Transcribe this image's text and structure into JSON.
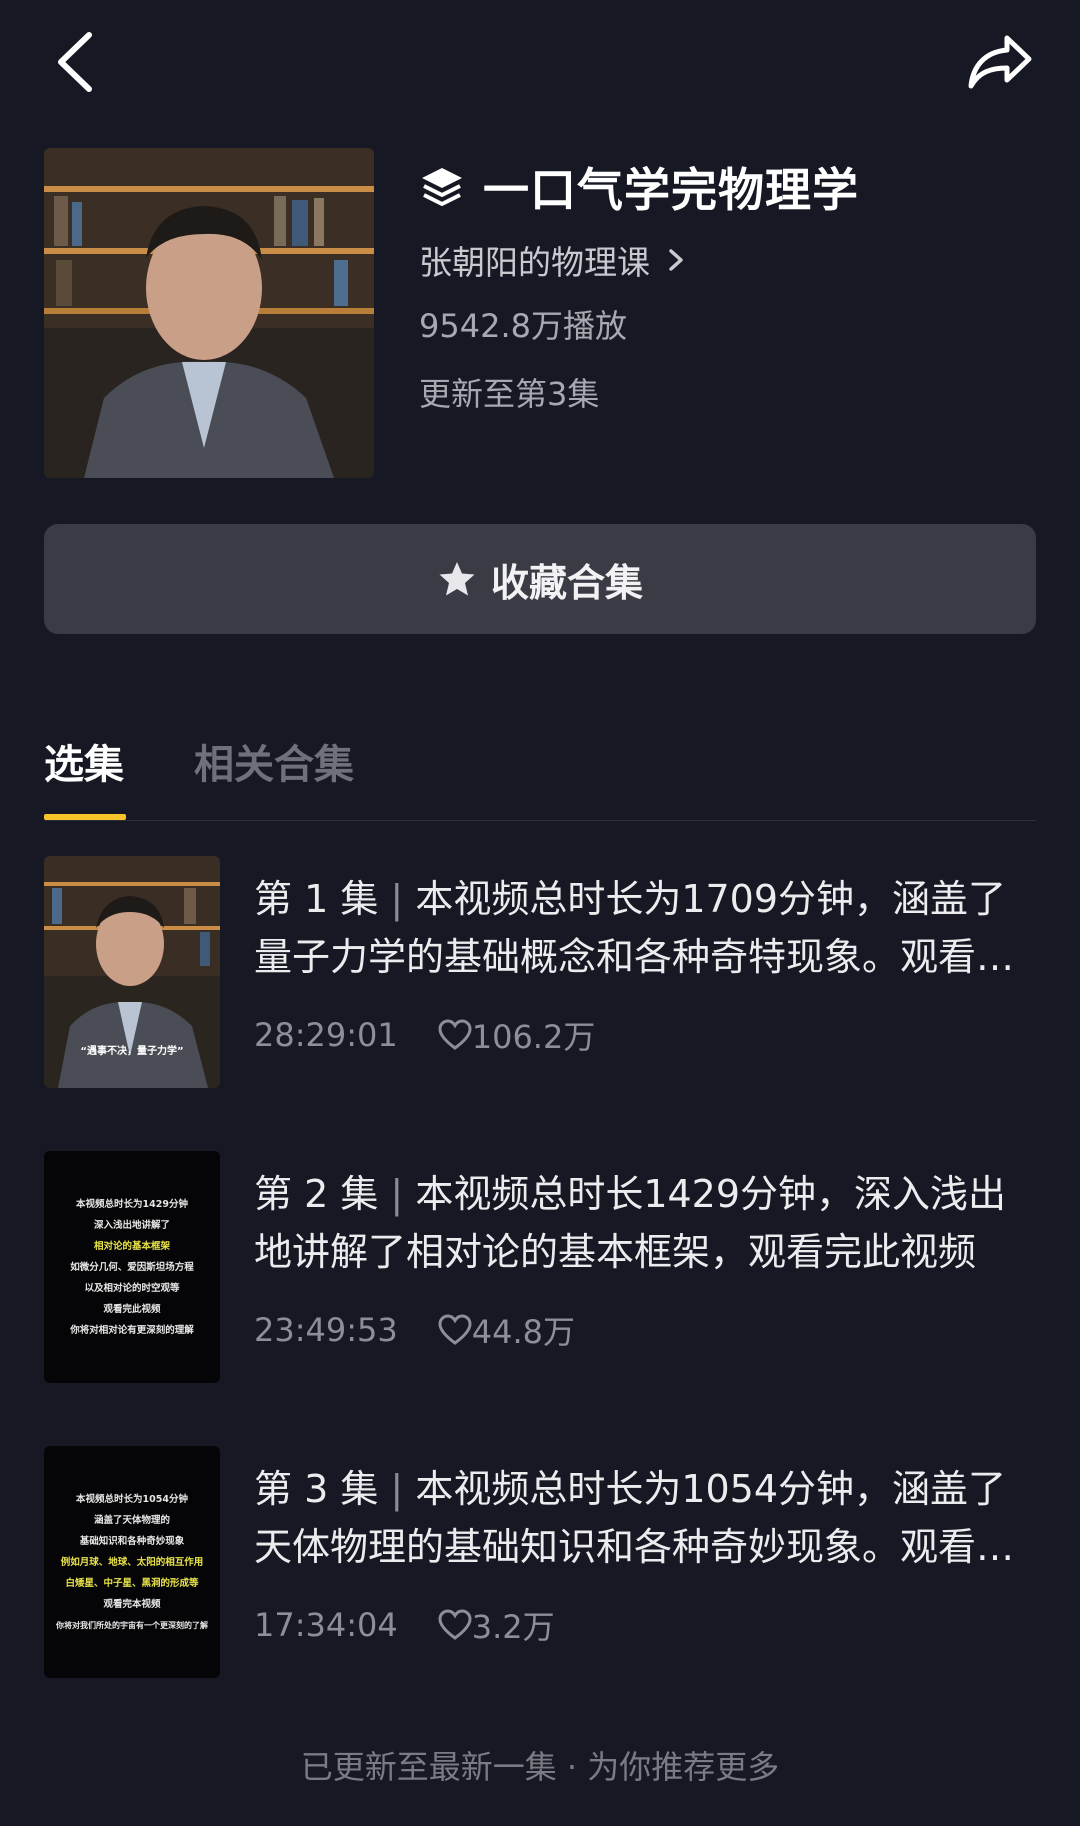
{
  "topbar": {
    "back_icon": "chevron-left-icon",
    "share_icon": "share-arrow-icon"
  },
  "collection": {
    "title": "一口气学完物理学",
    "icon": "layers-icon",
    "author": "张朝阳的物理课",
    "plays": "9542.8万播放",
    "update_status": "更新至第3集"
  },
  "favorite_button": {
    "label": "收藏合集",
    "icon": "star-icon"
  },
  "tabs": [
    {
      "label": "选集",
      "active": true
    },
    {
      "label": "相关合集",
      "active": false
    }
  ],
  "episodes": [
    {
      "number": "第 1 集",
      "description": "本视频总时长为1709分钟，涵盖了量子力学的基础概念和各种奇特现象。观看完此视频",
      "duration": "28:29:01",
      "likes": "106.2万",
      "thumb_caption": "“遇事不决，量子力学”"
    },
    {
      "number": "第 2 集",
      "description": "本视频总时长1429分钟，深入浅出地讲解了相对论的基本框架，观看完此视频",
      "duration": "23:49:53",
      "likes": "44.8万",
      "thumb_lines": [
        "本视频总时长为1429分钟",
        "深入浅出地讲解了",
        "相对论的基本框架",
        "如微分几何、爱因斯坦场方程",
        "以及相对论的时空观等",
        "观看完此视频",
        "你将对相对论有更深刻的理解"
      ]
    },
    {
      "number": "第 3 集",
      "description": "本视频总时长为1054分钟，涵盖了天体物理的基础知识和各种奇妙现象。观看完此视频",
      "duration": "17:34:04",
      "likes": "3.2万",
      "thumb_lines": [
        "本视频总时长为1054分钟",
        "涵盖了天体物理的",
        "基础知识和各种奇妙现象",
        "例如月球、地球、太阳的相互作用",
        "白矮星、中子星、黑洞的形成等",
        "观看完本视频",
        "你将对我们所处的宇宙有一个更深刻的了解"
      ]
    }
  ],
  "footer": "已更新至最新一集 · 为你推荐更多",
  "colors": {
    "background": "#161823",
    "accent": "#f8c42a",
    "button_bg": "#3a3b44"
  }
}
